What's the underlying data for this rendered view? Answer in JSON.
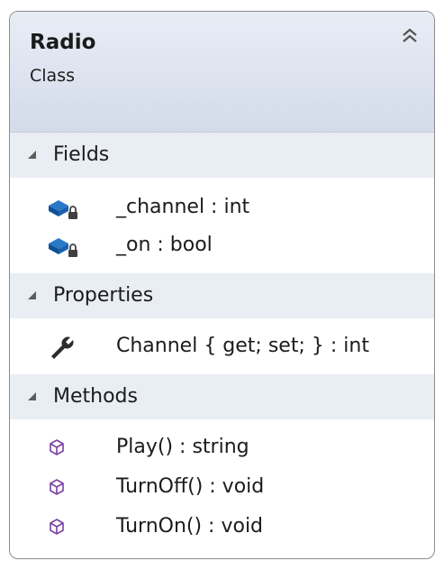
{
  "class": {
    "name": "Radio",
    "kind": "Class"
  },
  "sections": {
    "fields": {
      "label": "Fields",
      "items": [
        {
          "text": "_channel : int",
          "icon": "private-field-icon"
        },
        {
          "text": "_on : bool",
          "icon": "private-field-icon"
        }
      ]
    },
    "properties": {
      "label": "Properties",
      "items": [
        {
          "text": "Channel { get; set; } : int",
          "icon": "property-wrench-icon"
        }
      ]
    },
    "methods": {
      "label": "Methods",
      "items": [
        {
          "text": "Play() : string",
          "icon": "method-cube-icon"
        },
        {
          "text": "TurnOff() : void",
          "icon": "method-cube-icon"
        },
        {
          "text": "TurnOn() : void",
          "icon": "method-cube-icon"
        }
      ]
    }
  },
  "colors": {
    "header_gradient_top": "#e8ecf5",
    "section_background": "#e9edf4",
    "field_icon": "#1e64b4",
    "method_icon": "#7a3fa3"
  }
}
